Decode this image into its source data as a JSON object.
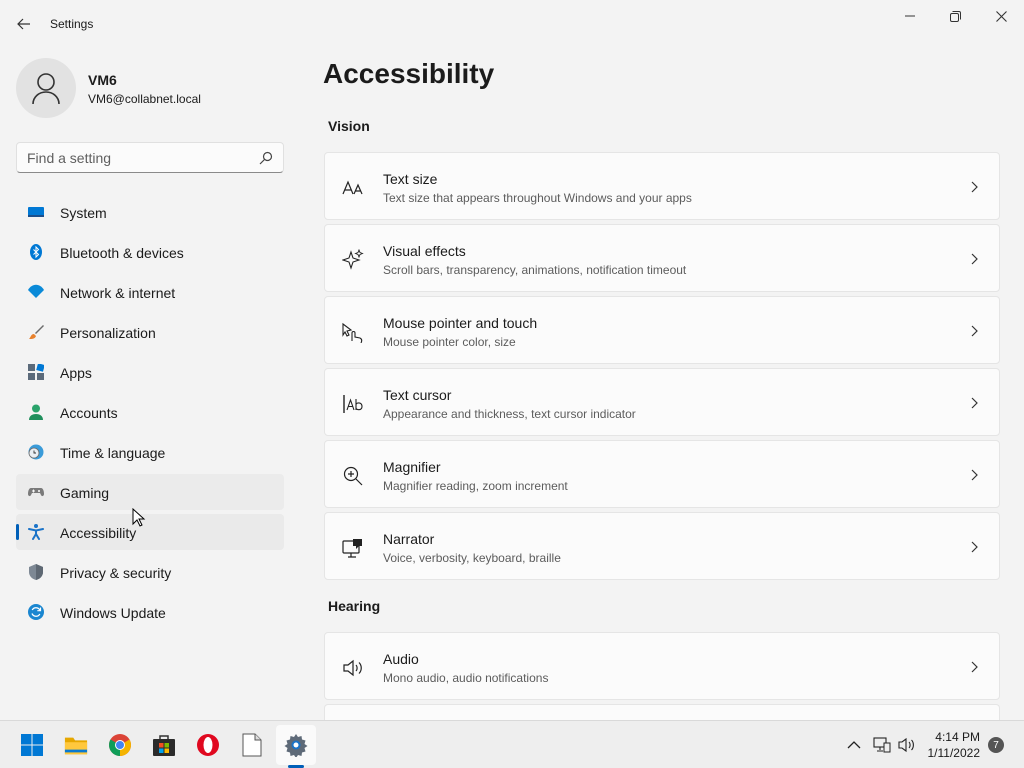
{
  "window": {
    "title": "Settings"
  },
  "user": {
    "name": "VM6",
    "email": "VM6@collabnet.local"
  },
  "search": {
    "placeholder": "Find a setting"
  },
  "nav": {
    "items": [
      {
        "label": "System",
        "icon": "system-icon"
      },
      {
        "label": "Bluetooth & devices",
        "icon": "bluetooth-icon"
      },
      {
        "label": "Network & internet",
        "icon": "wifi-icon"
      },
      {
        "label": "Personalization",
        "icon": "brush-icon"
      },
      {
        "label": "Apps",
        "icon": "apps-icon"
      },
      {
        "label": "Accounts",
        "icon": "person-icon"
      },
      {
        "label": "Time & language",
        "icon": "clock-globe-icon"
      },
      {
        "label": "Gaming",
        "icon": "controller-icon"
      },
      {
        "label": "Accessibility",
        "icon": "accessibility-icon"
      },
      {
        "label": "Privacy & security",
        "icon": "shield-icon"
      },
      {
        "label": "Windows Update",
        "icon": "update-icon"
      }
    ],
    "selected": "Accessibility",
    "hovered": "Gaming"
  },
  "main": {
    "title": "Accessibility",
    "sections": [
      {
        "label": "Vision",
        "cards": [
          {
            "title": "Text size",
            "subtitle": "Text size that appears throughout Windows and your apps",
            "icon": "text-size-icon"
          },
          {
            "title": "Visual effects",
            "subtitle": "Scroll bars, transparency, animations, notification timeout",
            "icon": "sparkle-icon"
          },
          {
            "title": "Mouse pointer and touch",
            "subtitle": "Mouse pointer color, size",
            "icon": "pointer-touch-icon"
          },
          {
            "title": "Text cursor",
            "subtitle": "Appearance and thickness, text cursor indicator",
            "icon": "text-cursor-icon"
          },
          {
            "title": "Magnifier",
            "subtitle": "Magnifier reading, zoom increment",
            "icon": "magnifier-icon"
          },
          {
            "title": "Narrator",
            "subtitle": "Voice, verbosity, keyboard, braille",
            "icon": "narrator-icon"
          }
        ]
      },
      {
        "label": "Hearing",
        "cards": [
          {
            "title": "Audio",
            "subtitle": "Mono audio, audio notifications",
            "icon": "speaker-icon"
          }
        ]
      }
    ]
  },
  "taskbar": {
    "apps": [
      "start-icon",
      "file-explorer-icon",
      "chrome-icon",
      "store-icon",
      "opera-icon",
      "notepad-icon",
      "settings-icon"
    ],
    "time": "4:14 PM",
    "date": "1/11/2022",
    "notifications": "7"
  },
  "colors": {
    "accent": "#005fb8",
    "background": "#f3f3f3",
    "card": "#fbfbfb"
  }
}
